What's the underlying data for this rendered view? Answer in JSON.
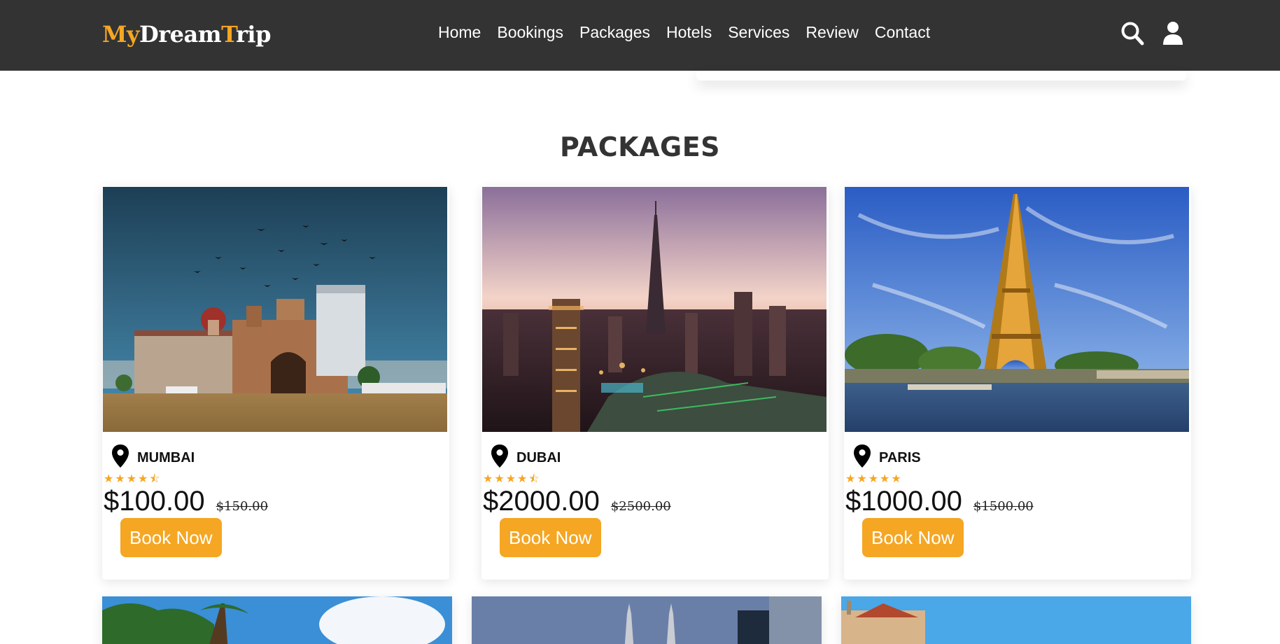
{
  "header": {
    "logo": {
      "part1": "My",
      "part2": "Dream",
      "part3": "T",
      "part4": "rip"
    },
    "nav": [
      "Home",
      "Bookings",
      "Packages",
      "Hotels",
      "Services",
      "Review",
      "Contact"
    ],
    "icons": {
      "search": "search-icon",
      "user": "user-icon"
    }
  },
  "section": {
    "title": "PACKAGES"
  },
  "colors": {
    "header_bg": "#333333",
    "accent": "#f5a623"
  },
  "packages": [
    {
      "city": "MUMBAI",
      "price": "$100.00",
      "old_price": "$150.00",
      "rating": 4.5,
      "button": "Book Now"
    },
    {
      "city": "DUBAI",
      "price": "$2000.00",
      "old_price": "$2500.00",
      "rating": 4.5,
      "button": "Book Now"
    },
    {
      "city": "PARIS",
      "price": "$1000.00",
      "old_price": "$1500.00",
      "rating": 5,
      "button": "Book Now"
    }
  ]
}
